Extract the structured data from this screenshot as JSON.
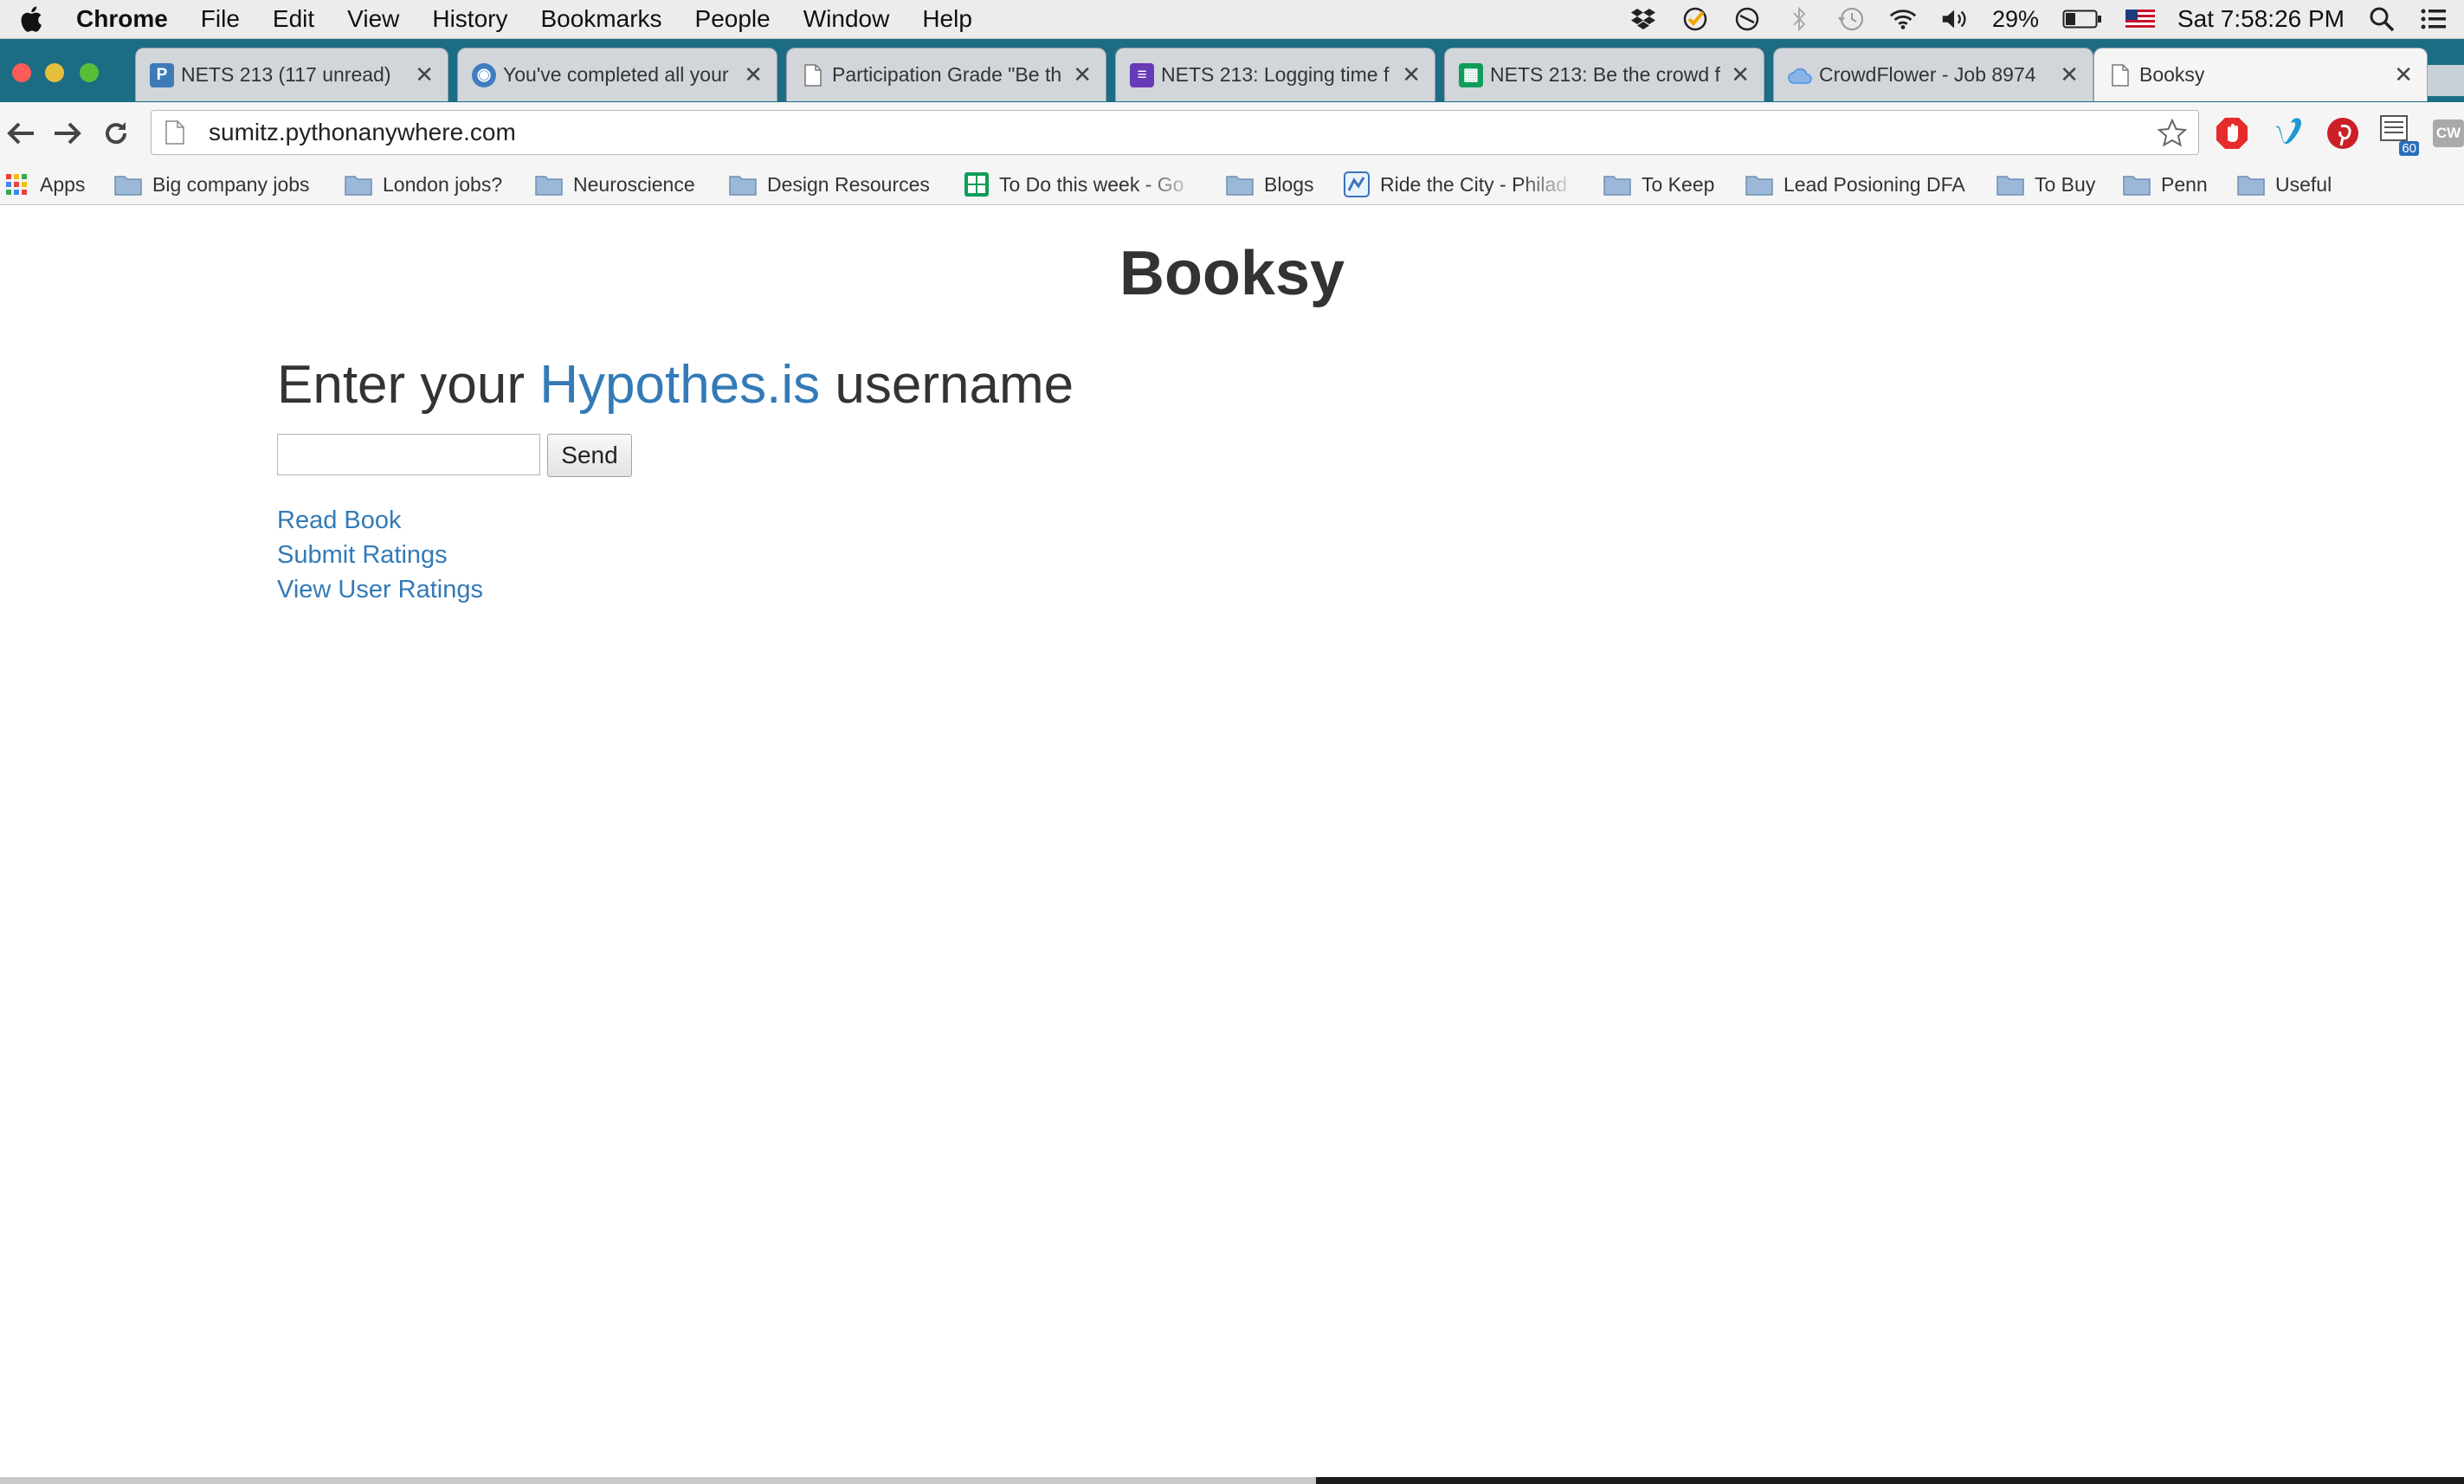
{
  "menubar": {
    "app": "Chrome",
    "items": [
      "File",
      "Edit",
      "View",
      "History",
      "Bookmarks",
      "People",
      "Window",
      "Help"
    ],
    "battery": "29%",
    "clock": "Sat 7:58:26 PM",
    "icons": [
      "dropbox-icon",
      "checkmark-icon",
      "block-icon",
      "bluetooth-icon",
      "time-machine-icon",
      "wifi-icon",
      "volume-icon",
      "battery-icon",
      "us-flag-icon",
      "spotlight-icon",
      "notification-list-icon"
    ]
  },
  "tabs": [
    {
      "title": "NETS 213 (117 unread)",
      "icon": "piazza-icon",
      "color": "#3d7ab8"
    },
    {
      "title": "You've completed all your",
      "icon": "globe-icon",
      "color": "#3f7cc0"
    },
    {
      "title": "Participation Grade \"Be th",
      "icon": "page-icon",
      "color": "#ffffff"
    },
    {
      "title": "NETS 213: Logging time f",
      "icon": "forms-icon",
      "color": "#673ab7"
    },
    {
      "title": "NETS 213: Be the crowd f",
      "icon": "sheets-icon",
      "color": "#0f9d58"
    },
    {
      "title": "CrowdFlower - Job 8974",
      "icon": "crowdflower-icon",
      "color": "#4a90e2"
    },
    {
      "title": "Booksy",
      "icon": "page-icon",
      "color": "#ffffff"
    }
  ],
  "toolbar": {
    "url": "sumitz.pythonanywhere.com",
    "extensions": [
      "adblock-icon",
      "vimeo-icon",
      "pinterest-icon",
      "extension-60-icon",
      "cw-icon"
    ],
    "badge": "60",
    "cw_label": "CW"
  },
  "bookmarks": [
    {
      "label": "Apps",
      "icon": "apps-icon"
    },
    {
      "label": "Big company jobs",
      "icon": "folder-icon"
    },
    {
      "label": "London jobs?",
      "icon": "folder-icon"
    },
    {
      "label": "Neuroscience",
      "icon": "folder-icon"
    },
    {
      "label": "Design Resources",
      "icon": "folder-icon"
    },
    {
      "label": "To Do this week - Go",
      "icon": "sheets-icon"
    },
    {
      "label": "Blogs",
      "icon": "folder-icon"
    },
    {
      "label": "Ride the City - Philad",
      "icon": "ridethecity-icon"
    },
    {
      "label": "To Keep",
      "icon": "folder-icon"
    },
    {
      "label": "Lead Posioning DFA",
      "icon": "folder-icon"
    },
    {
      "label": "To Buy",
      "icon": "folder-icon"
    },
    {
      "label": "Penn",
      "icon": "folder-icon"
    },
    {
      "label": "Useful",
      "icon": "folder-icon"
    }
  ],
  "page": {
    "title": "Booksy",
    "prompt_before": "Enter your ",
    "prompt_link": "Hypothes.is",
    "prompt_after": " username",
    "input_value": "",
    "send_label": "Send",
    "links": [
      "Read Book",
      "Submit Ratings",
      "View User Ratings"
    ]
  },
  "colors": {
    "link": "#337ab7",
    "tabstrip": "#1c6d84",
    "heading": "#333333"
  }
}
